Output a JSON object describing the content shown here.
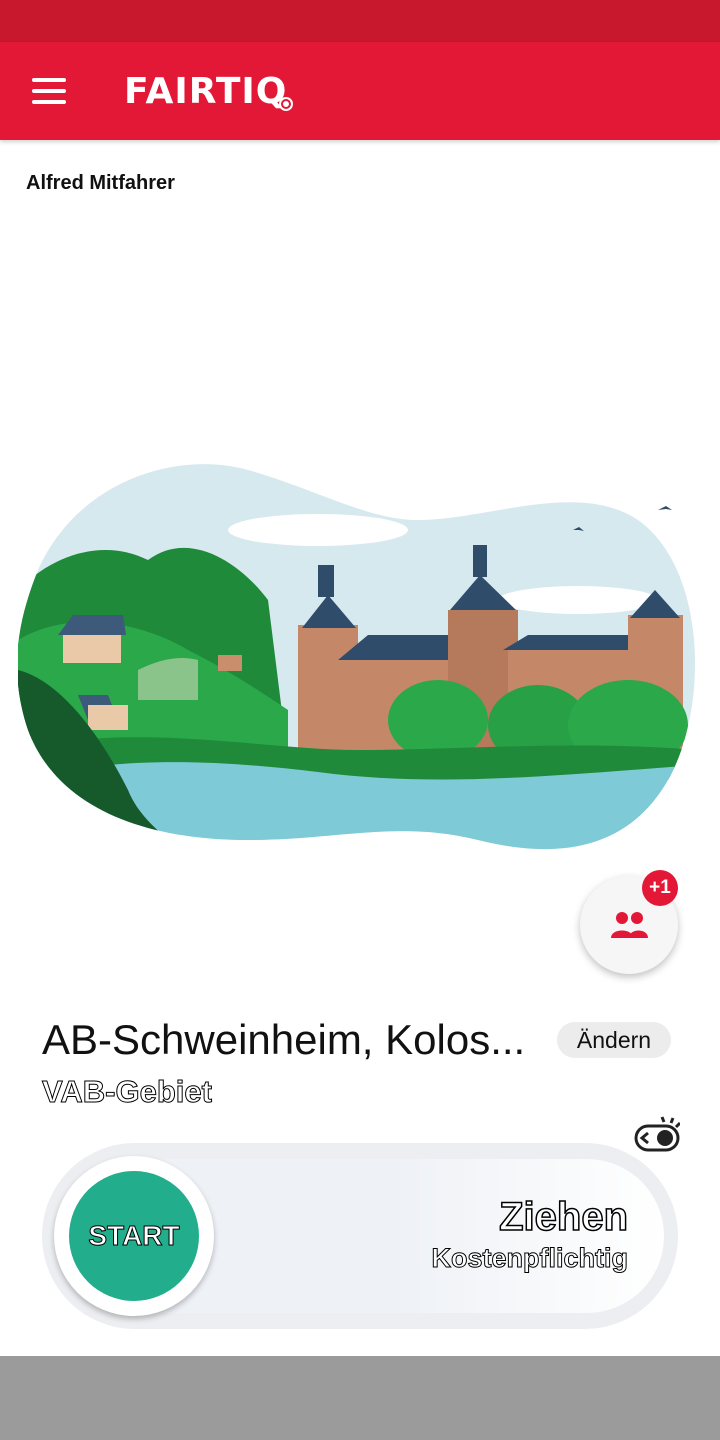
{
  "app": {
    "logo_text": "FAIRTIQ",
    "brand_color": "#e31837"
  },
  "header": {
    "menu_icon": "hamburger-menu-icon"
  },
  "user": {
    "name": "Alfred Mitfahrer"
  },
  "illustration": {
    "icon": "castle-landscape-illustration"
  },
  "passengers": {
    "badge": "+1",
    "icon": "people-icon"
  },
  "location": {
    "station": "AB-Schweinheim, Kolos...",
    "zone": "VAB-Gebiet",
    "change_label": "Ändern"
  },
  "slider": {
    "start_label": "START",
    "action_label": "Ziehen",
    "cost_label": "Kostenpflichtig",
    "accent": "#22ae8c"
  },
  "toggle": {
    "icon": "privacy-toggle-icon"
  }
}
